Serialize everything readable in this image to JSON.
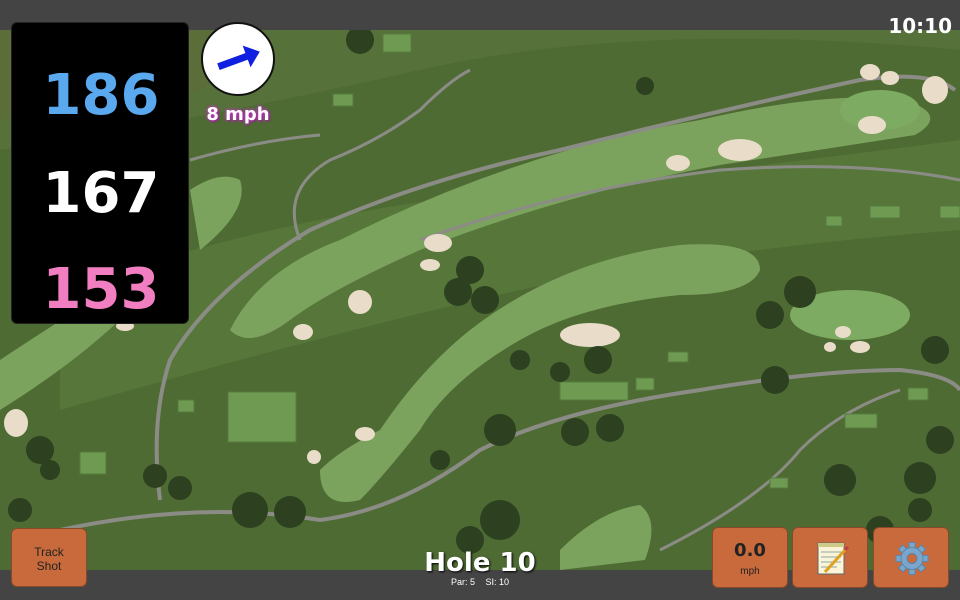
{
  "status": {
    "clock": "10:10"
  },
  "yardage": {
    "back": "186",
    "middle": "167",
    "front": "153"
  },
  "wind": {
    "speed": "8 mph",
    "arrow_icon": "arrow-right-icon",
    "arrow_color": "#1020e0"
  },
  "hole": {
    "title": "Hole 10",
    "par": "Par: 5",
    "stroke_index": "SI: 10"
  },
  "buttons": {
    "track_shot": "Track\nShot",
    "speed_value": "0.0",
    "speed_unit": "mph",
    "notes_icon": "notepad-icon",
    "settings_icon": "gear-icon"
  },
  "colors": {
    "back_yardage": "#5aa8ee",
    "middle_yardage": "#ffffff",
    "front_yardage": "#f07ec0",
    "button": "#c86a3c"
  }
}
